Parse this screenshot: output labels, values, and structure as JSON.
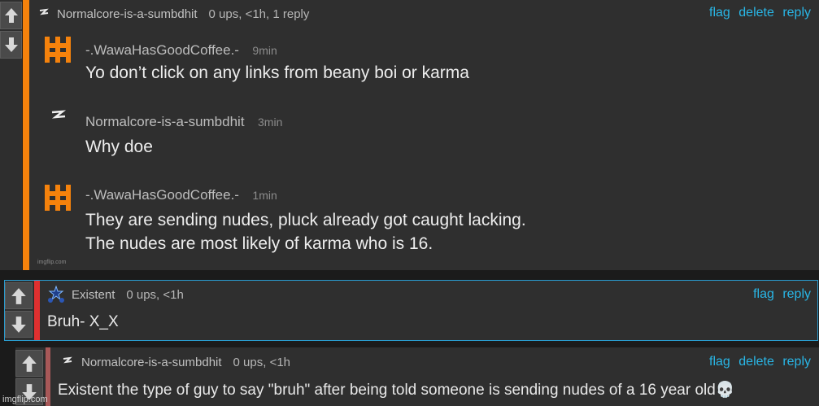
{
  "comment1": {
    "username": "Normalcore-is-a-sumbdhit",
    "meta": "0 ups, <1h, 1 reply",
    "actions": [
      "flag",
      "delete",
      "reply"
    ],
    "accent_color": "#f5820c",
    "image": {
      "messages": [
        {
          "user": "-.WawaHasGoodCoffee.-",
          "time": "9min",
          "lines": [
            "Yo don’t click on any links from beany boi or karma"
          ]
        },
        {
          "user": "Normalcore-is-a-sumbdhit",
          "time": "3min",
          "lines": [
            "Why doe"
          ]
        },
        {
          "user": "-.WawaHasGoodCoffee.-",
          "time": "1min",
          "lines": [
            "They are sending nudes, pluck already got caught lacking.",
            "The nudes are most likely of karma who is 16."
          ]
        }
      ],
      "watermark": "imgflip.com"
    }
  },
  "comment2": {
    "username": "Existent",
    "meta": "0 ups, <1h",
    "actions": [
      "flag",
      "reply"
    ],
    "text": "Bruh- X_X",
    "accent_color": "#e03030"
  },
  "comment3": {
    "username": "Normalcore-is-a-sumbdhit",
    "meta": "0 ups, <1h",
    "actions": [
      "flag",
      "delete",
      "reply"
    ],
    "text": "Existent the type of guy to say \"bruh\" after being told someone is sending nudes of a 16 year old💀",
    "accent_color": "#a85858"
  },
  "watermark_bottom": "imgflip.com",
  "icons": {
    "upvote": "up-arrow-icon",
    "downvote": "down-arrow-icon",
    "wawa_avatar": "orange-symbol-avatar",
    "normalcore_avatar": "lightning-avatar",
    "existent_avatar": "star-cluster-avatar"
  }
}
